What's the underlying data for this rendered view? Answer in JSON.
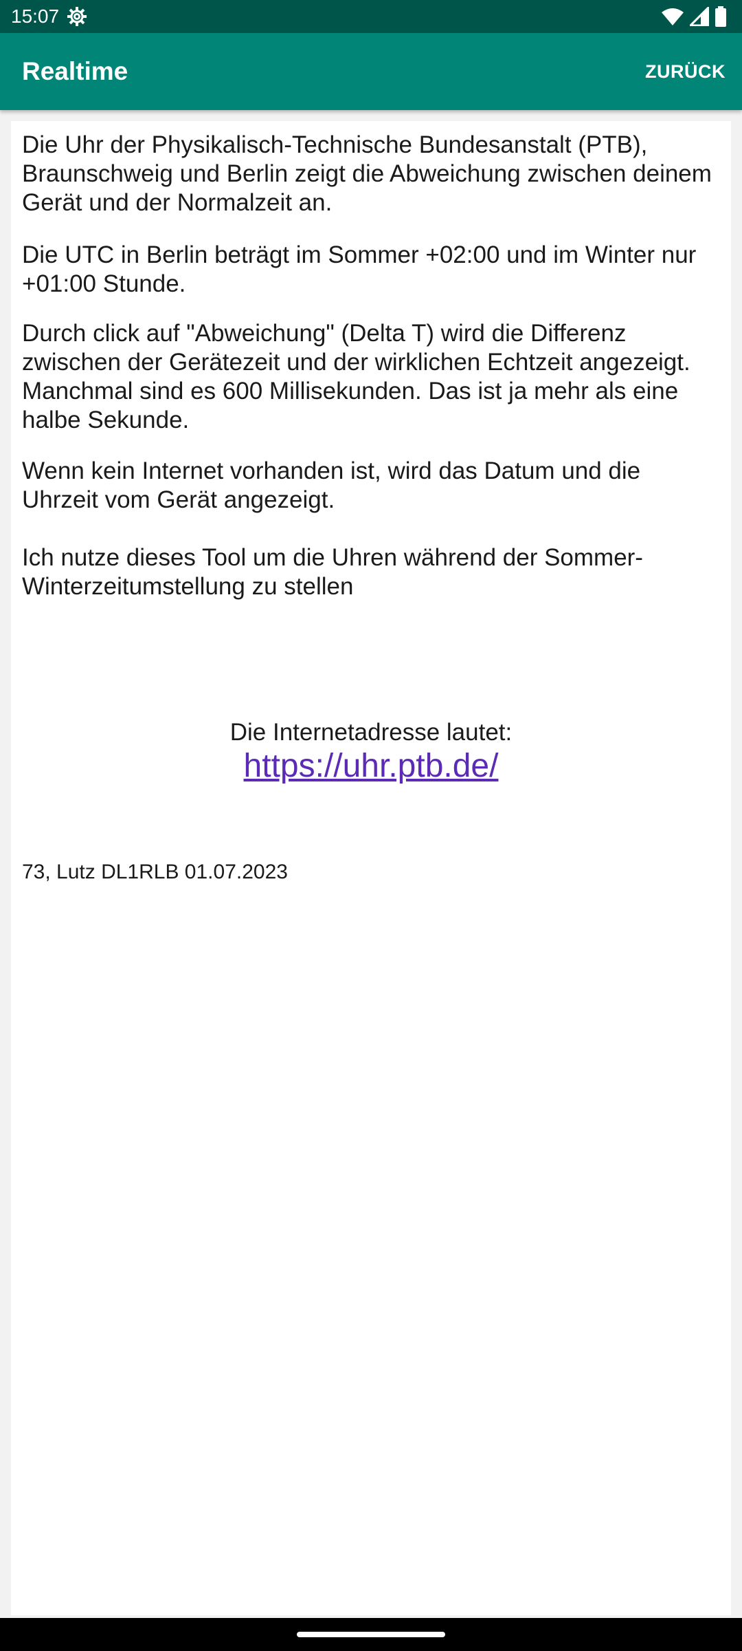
{
  "status_bar": {
    "time": "15:07",
    "icons": [
      "settings-gear-icon",
      "wifi-icon",
      "cell-signal-icon",
      "battery-icon"
    ]
  },
  "app_bar": {
    "title": "Realtime",
    "back_label": "ZURÜCK",
    "color": "#008577",
    "status_color": "#00554a"
  },
  "content": {
    "paragraphs": [
      "Die Uhr der Physikalisch-Technische Bundesanstalt (PTB), Braunschweig und Berlin zeigt die Abweichung zwischen deinem Gerät und der Normalzeit an.",
      "Die UTC in Berlin beträgt im Sommer +02:00 und im Winter nur +01:00 Stunde.",
      "Durch click auf \"Abweichung\" (Delta T) wird die Differenz zwischen der Gerätezeit und der wirklichen Echtzeit angezeigt. Manchmal sind es 600 Millisekunden. Das ist ja mehr als eine halbe Sekunde.",
      "Wenn kein Internet vorhanden ist, wird das Datum und die Uhrzeit vom Gerät angezeigt.",
      "Ich nutze dieses Tool um die Uhren während der Sommer-Winterzeitumstellung zu stellen"
    ],
    "address_label": "Die Internetadresse lautet:",
    "address_link": "https://uhr.ptb.de/",
    "link_color": "#5b2bb5",
    "signature": "73, Lutz DL1RLB 01.07.2023"
  }
}
